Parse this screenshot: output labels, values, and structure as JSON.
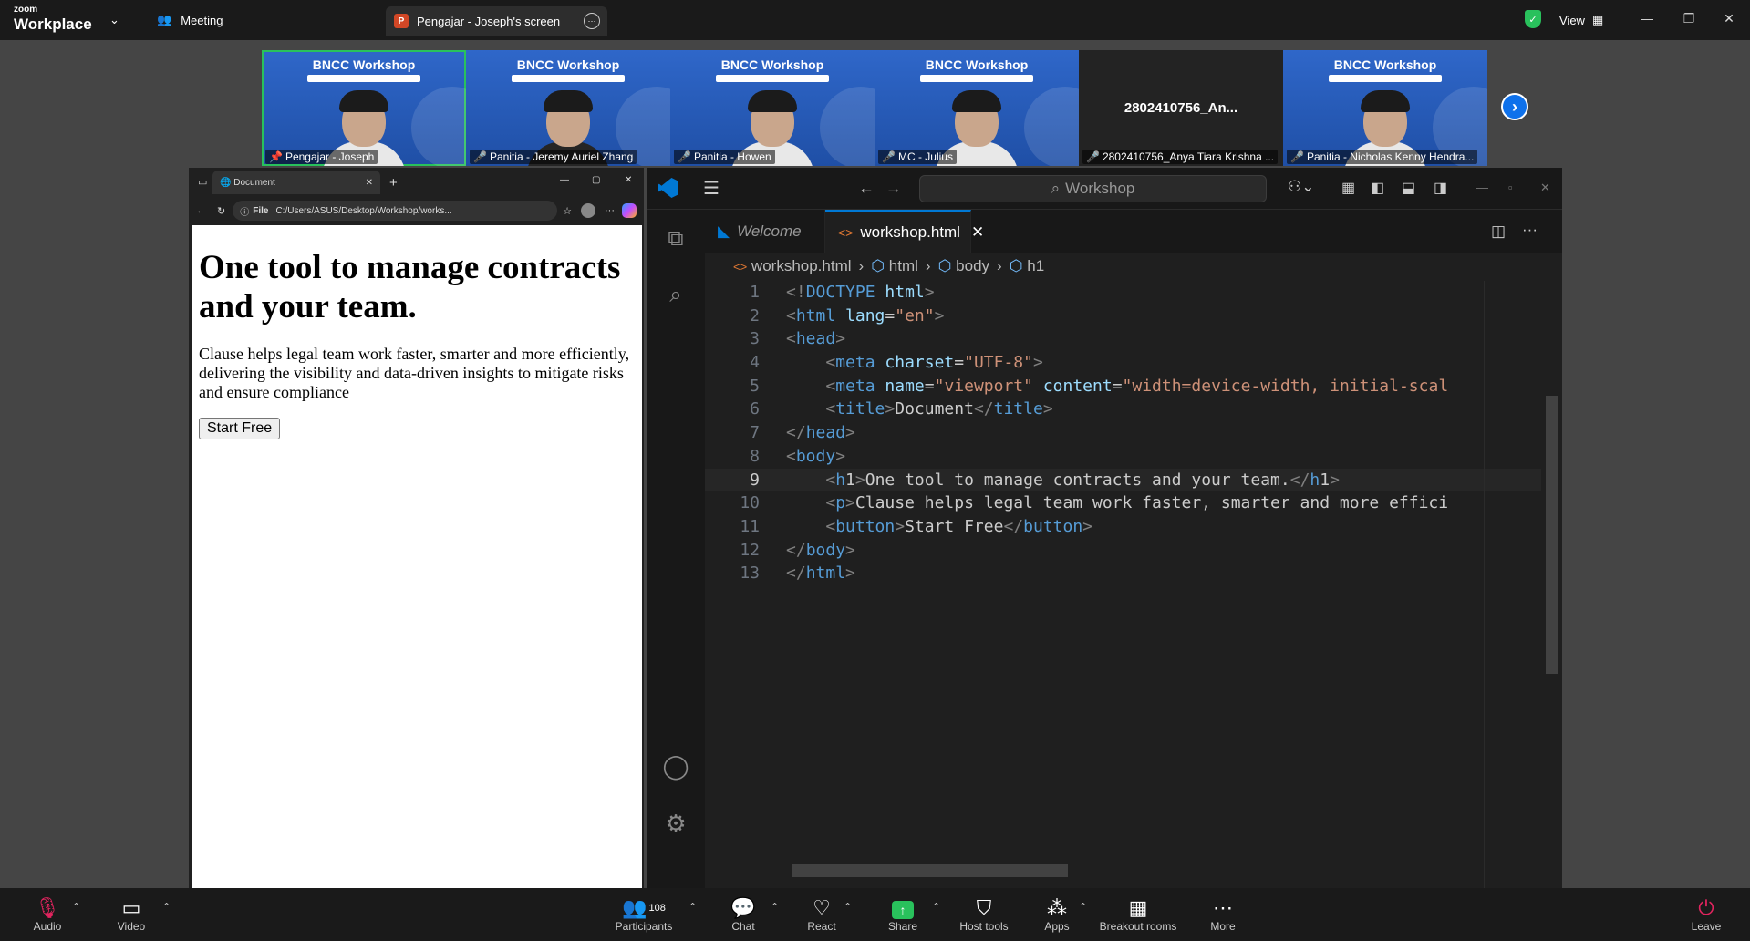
{
  "titlebar": {
    "logo_line1": "zoom",
    "logo_line2": "Workplace",
    "meeting_label": "Meeting",
    "share_tab_icon": "P",
    "share_tab_label": "Pengajar - Joseph's screen",
    "view_label": "View",
    "shield_color": "#29c15c"
  },
  "thumbnails": [
    {
      "name": "Pengajar - Joseph",
      "slide_title": "BNCC Workshop",
      "pinned": true,
      "muted": false
    },
    {
      "name": "Panitia - Jeremy Auriel Zhang",
      "slide_title": "BNCC Workshop",
      "muted": true
    },
    {
      "name": "Panitia - Howen",
      "slide_title": "BNCC Workshop",
      "muted": true
    },
    {
      "name": "MC - Julius",
      "slide_title": "BNCC Workshop",
      "muted": true
    },
    {
      "name": "2802410756_Anya Tiara Krishna ...",
      "big_label": "2802410756_An...",
      "muted": true
    },
    {
      "name": "Panitia - Nicholas Kenny Hendra...",
      "slide_title": "BNCC Workshop",
      "muted": true
    }
  ],
  "browser": {
    "tab_title": "Document",
    "url_prefix": "File",
    "url": "C:/Users/ASUS/Desktop/Workshop/works...",
    "page": {
      "heading": "One tool to manage contracts and your team.",
      "paragraph": "Clause helps legal team work faster, smarter and more efficiently, delivering the visibility and data-driven insights to mitigate risks and ensure compliance",
      "button": "Start Free"
    }
  },
  "vscode": {
    "search_placeholder": "Workshop",
    "tabs": [
      {
        "label": "Welcome",
        "active": false
      },
      {
        "label": "workshop.html",
        "active": true
      }
    ],
    "breadcrumbs": [
      "workshop.html",
      "html",
      "body",
      "h1"
    ],
    "current_line": 9,
    "lines": [
      "<!DOCTYPE html>",
      "<html lang=\"en\">",
      "<head>",
      "    <meta charset=\"UTF-8\">",
      "    <meta name=\"viewport\" content=\"width=device-width, initial-scal",
      "    <title>Document</title>",
      "</head>",
      "<body>",
      "    <h1>One tool to manage contracts and your team.</h1>",
      "    <p>Clause helps legal team work faster, smarter and more effici",
      "    <button>Start Free</button>",
      "</body>",
      "</html>"
    ]
  },
  "toolbar": {
    "audio": "Audio",
    "video": "Video",
    "participants": "Participants",
    "participants_count": "108",
    "chat": "Chat",
    "react": "React",
    "share": "Share",
    "host_tools": "Host tools",
    "apps": "Apps",
    "breakout_rooms": "Breakout rooms",
    "more": "More",
    "leave": "Leave",
    "share_color": "#29c15c"
  }
}
